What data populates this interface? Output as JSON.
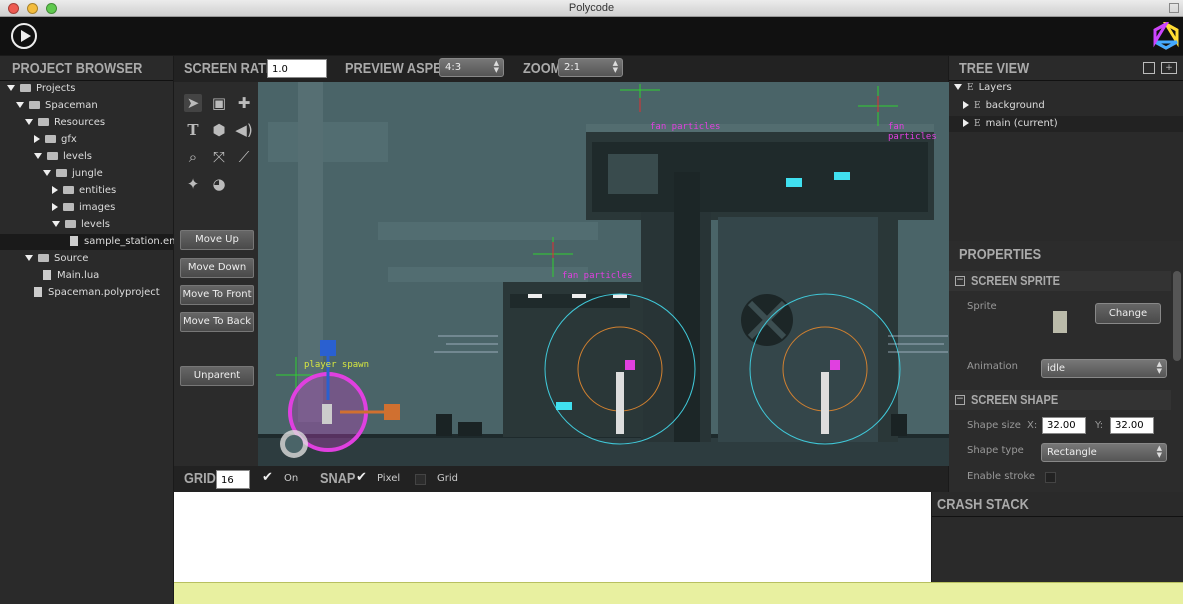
{
  "window": {
    "title": "Polycode"
  },
  "project_browser": {
    "heading": "PROJECT BROWSER",
    "items": [
      {
        "label": "Projects",
        "indent": 0,
        "type": "folder",
        "open": true
      },
      {
        "label": "Spaceman",
        "indent": 1,
        "type": "project",
        "open": true
      },
      {
        "label": "Resources",
        "indent": 2,
        "type": "folder",
        "open": true
      },
      {
        "label": "gfx",
        "indent": 3,
        "type": "folder",
        "open": false
      },
      {
        "label": "levels",
        "indent": 3,
        "type": "folder",
        "open": true
      },
      {
        "label": "jungle",
        "indent": 4,
        "type": "folder",
        "open": true
      },
      {
        "label": "entities",
        "indent": 5,
        "type": "folder",
        "open": false
      },
      {
        "label": "images",
        "indent": 5,
        "type": "folder",
        "open": false
      },
      {
        "label": "levels",
        "indent": 5,
        "type": "folder",
        "open": true
      },
      {
        "label": "sample_station.en",
        "indent": 6,
        "type": "file",
        "selected": true
      },
      {
        "label": "Source",
        "indent": 2,
        "type": "folder",
        "open": true
      },
      {
        "label": "Main.lua",
        "indent": 3,
        "type": "file"
      },
      {
        "label": "Spaceman.polyproject",
        "indent": 2,
        "type": "file"
      }
    ]
  },
  "editor_bar": {
    "screen_ratio_label": "SCREEN RATIO",
    "screen_ratio_value": "1.0",
    "preview_aspect_label": "PREVIEW ASPECT",
    "preview_aspect_value": "4:3",
    "zoom_label": "ZOOM",
    "zoom_value": "2:1"
  },
  "tools": {
    "icons": [
      "select-arrow-icon",
      "image-icon",
      "move-cross-icon",
      "text-icon",
      "shape-hexagon-icon",
      "sound-icon",
      "zoom-magnifier-icon",
      "scale-icon",
      "link-icon",
      "particle-add-icon",
      "pie-icon"
    ],
    "buttons": {
      "move_up": "Move Up",
      "move_down": "Move Down",
      "move_to_front": "Move To Front",
      "move_to_back": "Move To Back",
      "unparent": "Unparent"
    }
  },
  "scene": {
    "labels": {
      "fan_particles_1": "fan particles",
      "fan_particles_2": "fan particles",
      "fan_particles_3": "fan particles",
      "player_spawn": "player spawn"
    }
  },
  "grid_bar": {
    "grid_label": "GRID",
    "grid_value": "16",
    "on_label": "On",
    "on_checked": true,
    "snap_label": "SNAP",
    "pixel_label": "Pixel",
    "pixel_checked": true,
    "grid_snap_label": "Grid",
    "grid_snap_checked": false
  },
  "tree_view": {
    "heading": "TREE VIEW",
    "items": [
      {
        "label": "Layers",
        "indent": 0,
        "open": true
      },
      {
        "label": "background",
        "indent": 1,
        "open": false
      },
      {
        "label": "main (current)",
        "indent": 1,
        "open": false,
        "selected": true
      }
    ]
  },
  "properties": {
    "heading": "PROPERTIES",
    "screen_sprite": {
      "section": "SCREEN SPRITE",
      "sprite_label": "Sprite",
      "change_button": "Change",
      "animation_label": "Animation",
      "animation_value": "idle"
    },
    "screen_shape": {
      "section": "SCREEN SHAPE",
      "shape_size_label": "Shape size",
      "x_label": "X:",
      "x_value": "32.00",
      "y_label": "Y:",
      "y_value": "32.00",
      "shape_type_label": "Shape type",
      "shape_type_value": "Rectangle",
      "enable_stroke_label": "Enable stroke"
    }
  },
  "crash_stack": {
    "heading": "CRASH STACK"
  },
  "colors": {
    "scene_bg": "#465f63",
    "accent_magenta": "#e040e0",
    "accent_cyan": "#40c8d8",
    "accent_green": "#40e040",
    "status_bar": "#e8f0a0"
  }
}
